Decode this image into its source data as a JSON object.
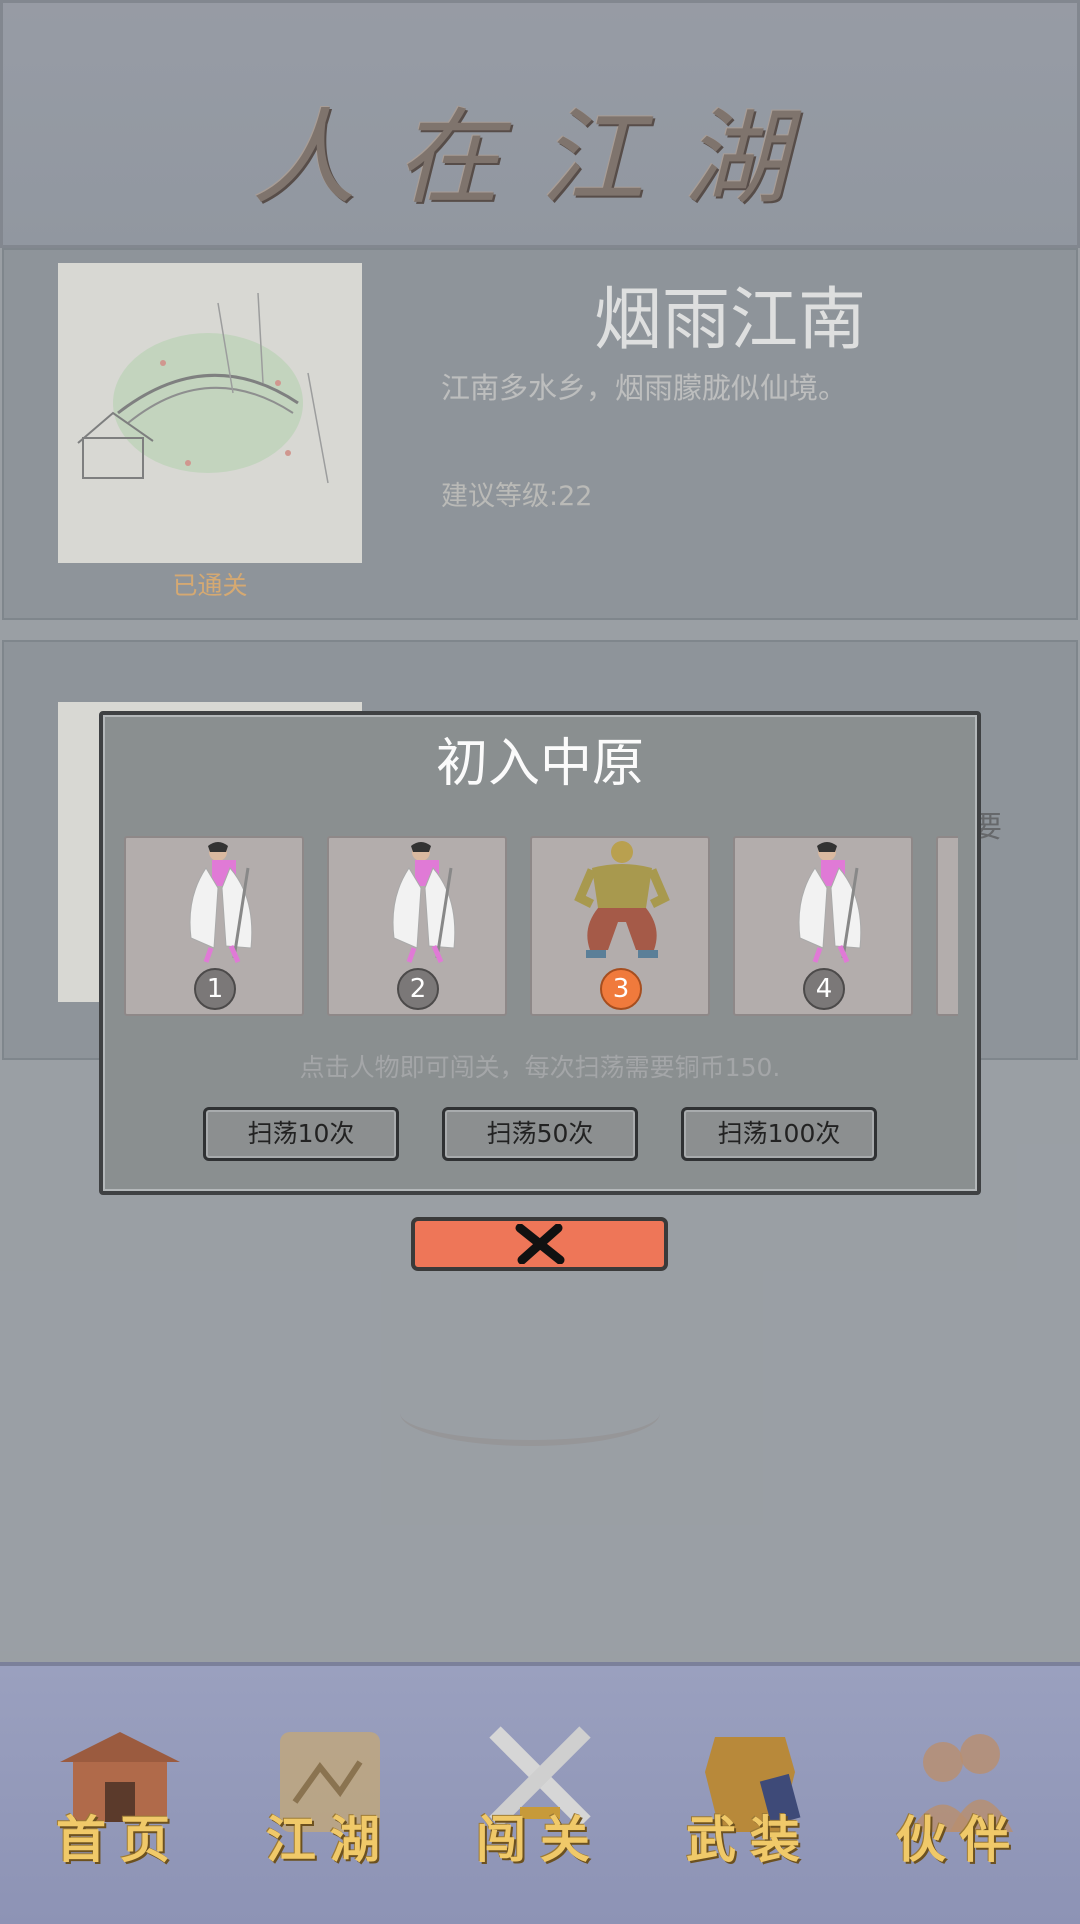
{
  "header": {
    "title": "人在江湖"
  },
  "levels": [
    {
      "name": "烟雨江南",
      "description": "江南多水乡，烟雨朦胧似仙境。",
      "recommended_level": "建议等级:22",
      "status": "已通关"
    }
  ],
  "card2_peek_text": "要",
  "modal": {
    "title": "初入中原",
    "enemies": [
      {
        "number": "1",
        "icon": "swordswoman-icon",
        "selected": false
      },
      {
        "number": "2",
        "icon": "swordswoman-icon",
        "selected": false
      },
      {
        "number": "3",
        "icon": "monk-brawler-icon",
        "selected": true
      },
      {
        "number": "4",
        "icon": "swordswoman-icon",
        "selected": false
      }
    ],
    "hint": "点击人物即可闯关，每次扫荡需要铜币150.",
    "buttons": {
      "sweep10": "扫荡10次",
      "sweep50": "扫荡50次",
      "sweep100": "扫荡100次"
    },
    "close_icon": "close-x-icon"
  },
  "nav": {
    "items": [
      {
        "label": "首页",
        "icon": "temple-icon"
      },
      {
        "label": "江湖",
        "icon": "scroll-map-icon"
      },
      {
        "label": "闯关",
        "icon": "crossed-swords-icon"
      },
      {
        "label": "武装",
        "icon": "armor-icon"
      },
      {
        "label": "伙伴",
        "icon": "companions-icon"
      }
    ]
  },
  "colors": {
    "accent": "#f07a3c",
    "close": "#ee7658",
    "nav_text": "#f0c969",
    "cleared": "#e9b77a"
  }
}
